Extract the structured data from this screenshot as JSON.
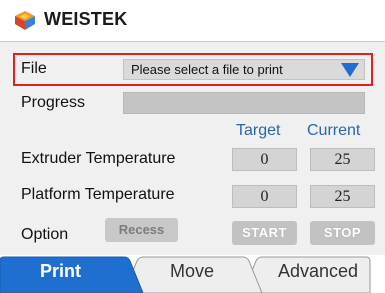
{
  "header": {
    "brand": "WEISTEK",
    "logo_icon": "weistek-logo-icon"
  },
  "file": {
    "label": "File",
    "placeholder": "Please select a file to print",
    "dropdown_icon": "triangle-down-icon"
  },
  "progress": {
    "label": "Progress",
    "value": 0
  },
  "columns": {
    "target": "Target",
    "current": "Current"
  },
  "extruder": {
    "label": "Extruder Temperature",
    "target": "0",
    "current": "25"
  },
  "platform": {
    "label": "Platform Temperature",
    "target": "0",
    "current": "25"
  },
  "option": {
    "label": "Option",
    "recess": "Recess"
  },
  "actions": {
    "start": "START",
    "stop": "STOP"
  },
  "tabs": [
    {
      "label": "Print",
      "active": true
    },
    {
      "label": "Move",
      "active": false
    },
    {
      "label": "Advanced",
      "active": false
    }
  ],
  "colors": {
    "accent": "#1f6fd1",
    "highlight_border": "#e32020",
    "column_heading": "#2e65a8"
  }
}
